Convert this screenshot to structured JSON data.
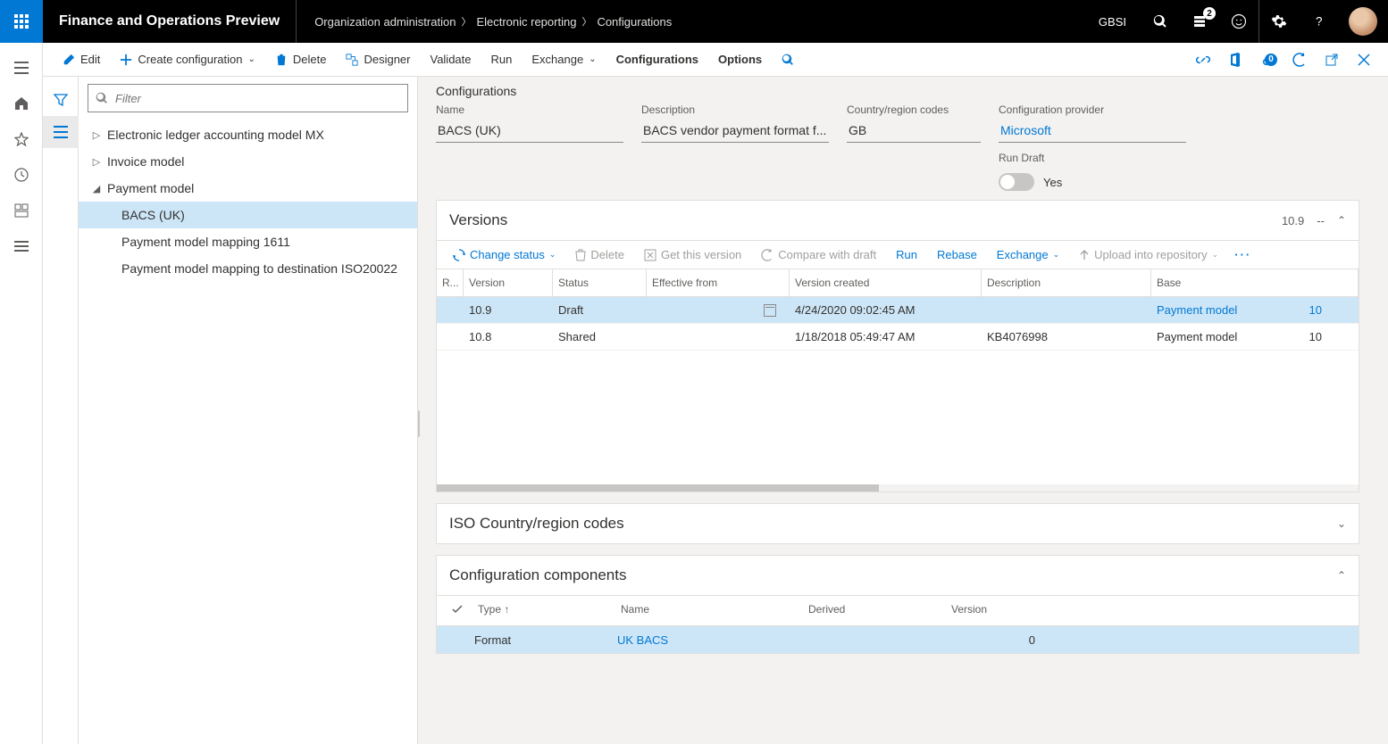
{
  "topbar": {
    "app_title": "Finance and Operations Preview",
    "breadcrumb": [
      "Organization administration",
      "Electronic reporting",
      "Configurations"
    ],
    "company": "GBSI",
    "notification_count": "2"
  },
  "toolbar": {
    "edit": "Edit",
    "create": "Create configuration",
    "delete": "Delete",
    "designer": "Designer",
    "validate": "Validate",
    "run": "Run",
    "exchange": "Exchange",
    "configurations": "Configurations",
    "options": "Options",
    "attach_count": "0"
  },
  "filter_placeholder": "Filter",
  "tree": {
    "n0": "Electronic ledger accounting model MX",
    "n1": "Invoice model",
    "n2": "Payment model",
    "n2_0": "BACS (UK)",
    "n2_1": "Payment model mapping 1611",
    "n2_2": "Payment model mapping to destination ISO20022"
  },
  "detail": {
    "section_title": "Configurations",
    "labels": {
      "name": "Name",
      "description": "Description",
      "country": "Country/region codes",
      "provider": "Configuration provider",
      "run_draft": "Run Draft"
    },
    "values": {
      "name": "BACS (UK)",
      "description": "BACS vendor payment format f...",
      "country": "GB",
      "provider": "Microsoft",
      "run_draft_state": "Yes"
    }
  },
  "versions": {
    "title": "Versions",
    "meta_version": "10.9",
    "meta_extra": "--",
    "toolbar": {
      "change_status": "Change status",
      "delete": "Delete",
      "get": "Get this version",
      "compare": "Compare with draft",
      "run": "Run",
      "rebase": "Rebase",
      "exchange": "Exchange",
      "upload": "Upload into repository"
    },
    "columns": {
      "r": "R...",
      "version": "Version",
      "status": "Status",
      "effective": "Effective from",
      "created": "Version created",
      "description": "Description",
      "base": "Base"
    },
    "rows": [
      {
        "version": "10.9",
        "status": "Draft",
        "effective": "",
        "created": "4/24/2020 09:02:45 AM",
        "description": "",
        "base": "Payment model",
        "base_ver": "10",
        "selected": true
      },
      {
        "version": "10.8",
        "status": "Shared",
        "effective": "",
        "created": "1/18/2018 05:49:47 AM",
        "description": "KB4076998",
        "base": "Payment model",
        "base_ver": "10",
        "selected": false
      }
    ]
  },
  "iso_section": {
    "title": "ISO Country/region codes"
  },
  "components": {
    "title": "Configuration components",
    "columns": {
      "type": "Type",
      "name": "Name",
      "derived": "Derived",
      "version": "Version"
    },
    "rows": [
      {
        "type": "Format",
        "name": "UK BACS",
        "derived": "",
        "version": "0"
      }
    ]
  }
}
